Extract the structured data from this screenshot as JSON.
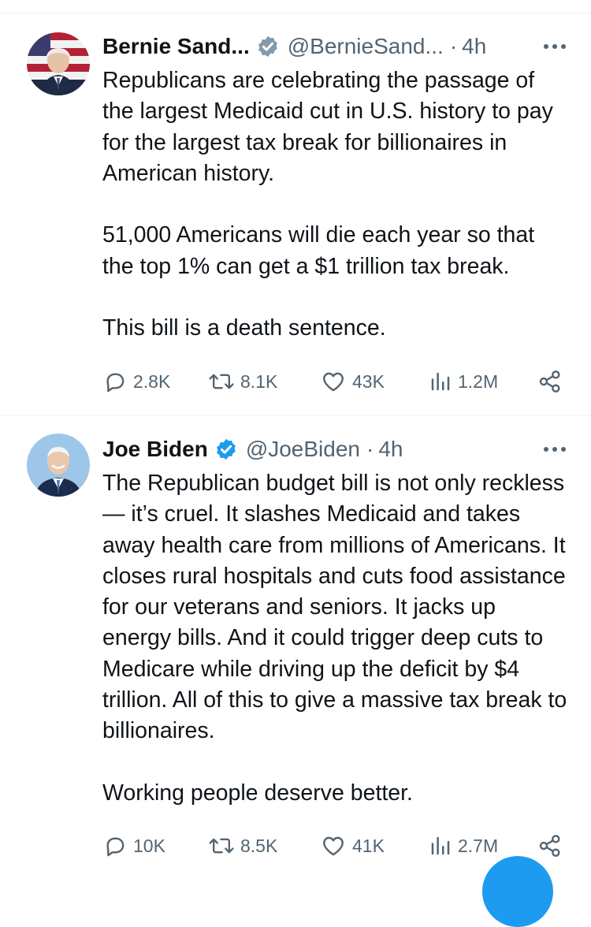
{
  "tweets": [
    {
      "display_name": "Bernie Sand...",
      "handle": "@BernieSand...",
      "separator": "·",
      "time": "4h",
      "text": "Republicans are celebrating the passage of the largest Medicaid cut in U.S. history to pay for the largest tax break for billionaires in American history.\n\n51,000 Americans will die each year so that the top 1% can get a $1 trillion tax break.\n\nThis bill is a death sentence.",
      "replies": "2.8K",
      "reposts": "8.1K",
      "likes": "43K",
      "views": "1.2M",
      "icons": {
        "verified": "verified-badge-icon",
        "reply": "reply-icon",
        "repost": "repost-icon",
        "like": "heart-icon",
        "views": "views-icon",
        "share": "share-icon",
        "more": "more-icon"
      }
    },
    {
      "display_name": "Joe Biden",
      "handle": "@JoeBiden",
      "separator": "·",
      "time": "4h",
      "text": "The Republican budget bill is not only reckless — it’s cruel. It slashes Medicaid and takes away health care from millions of Americans. It closes rural hospitals and cuts food assistance for our veterans and seniors. It jacks up energy bills. And it could trigger deep cuts to Medicare while driving up the deficit by $4 trillion. All of this to give a massive tax break to billionaires.\n\nWorking people deserve better.",
      "replies": "10K",
      "reposts": "8.5K",
      "likes": "41K",
      "views": "2.7M",
      "icons": {
        "verified": "verified-badge-icon",
        "reply": "reply-icon",
        "repost": "repost-icon",
        "like": "heart-icon",
        "views": "views-icon",
        "share": "share-icon",
        "more": "more-icon"
      }
    }
  ],
  "colors": {
    "text_primary": "#0f1419",
    "text_secondary": "#536471",
    "verified_gray": "#829aab",
    "verified_blue": "#1d9bf0",
    "divider": "#eff3f4"
  }
}
